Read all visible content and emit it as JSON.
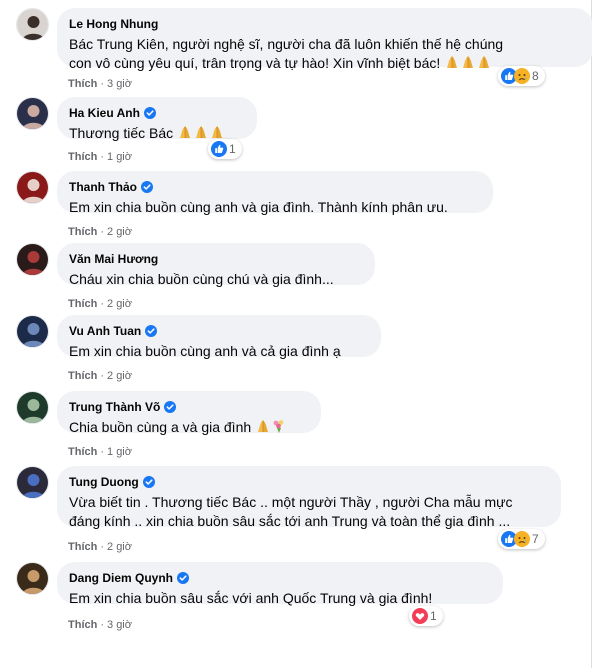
{
  "like_label": "Thích",
  "comments": [
    {
      "name": "Le Hong Nhung",
      "verified": false,
      "lines": [
        "Bác Trung Kiên, người nghệ sĩ, người cha đã luôn khiến thế hệ chúng",
        "con vô cùng yêu quí, trân trọng và tự hào! Xin vĩnh biệt bác!"
      ],
      "trailing_emoji": [
        "folded-hands",
        "folded-hands",
        "folded-hands"
      ],
      "time": "3 giờ",
      "reactions": [
        "like",
        "sad"
      ],
      "reaction_count": "8"
    },
    {
      "name": "Ha Kieu Anh",
      "verified": true,
      "lines": [
        "Thương tiếc Bác"
      ],
      "trailing_emoji": [
        "folded-hands",
        "folded-hands",
        "folded-hands"
      ],
      "time": "1 giờ",
      "reactions": [
        "like"
      ],
      "reaction_count": "1"
    },
    {
      "name": "Thanh Thảo",
      "verified": true,
      "lines": [
        "Em xin chia buồn cùng anh và gia đình. Thành kính phân ưu."
      ],
      "trailing_emoji": [],
      "time": "2 giờ",
      "reactions": [],
      "reaction_count": ""
    },
    {
      "name": "Văn Mai Hương",
      "verified": false,
      "lines": [
        "Cháu xin chia buồn cùng chú và gia đình..."
      ],
      "trailing_emoji": [],
      "time": "2 giờ",
      "reactions": [],
      "reaction_count": ""
    },
    {
      "name": "Vu Anh Tuan",
      "verified": true,
      "lines": [
        "Em xin chia buồn cùng anh và cả gia đình ạ"
      ],
      "trailing_emoji": [],
      "time": "2 giờ",
      "reactions": [],
      "reaction_count": ""
    },
    {
      "name": "Trung Thành Võ",
      "verified": true,
      "lines": [
        "Chia buồn cùng a và gia đình"
      ],
      "trailing_emoji": [
        "folded-hands",
        "bouquet"
      ],
      "time": "1 giờ",
      "reactions": [],
      "reaction_count": ""
    },
    {
      "name": "Tung Duong",
      "verified": true,
      "lines": [
        "Vừa biết tin . Thương tiếc Bác .. một người Thầy , người Cha mẫu mực",
        "đáng kính .. xin chia buồn sâu sắc tới anh Trung và toàn thể gia đình ..."
      ],
      "trailing_emoji": [],
      "time": "2 giờ",
      "reactions": [
        "like",
        "sad"
      ],
      "reaction_count": "7"
    },
    {
      "name": "Dang Diem Quynh",
      "verified": true,
      "lines": [
        "Em xin chia buồn sâu sắc với anh Quốc Trung và gia đình!"
      ],
      "trailing_emoji": [],
      "time": "3 giờ",
      "reactions": [
        "love"
      ],
      "reaction_count": "1"
    }
  ],
  "colors": {
    "bubble": "#f0f2f5",
    "meta": "#65676b",
    "verified": "#1877f2",
    "like": "#1877f2",
    "sad": "#f7b125",
    "love": "#f33e58"
  }
}
